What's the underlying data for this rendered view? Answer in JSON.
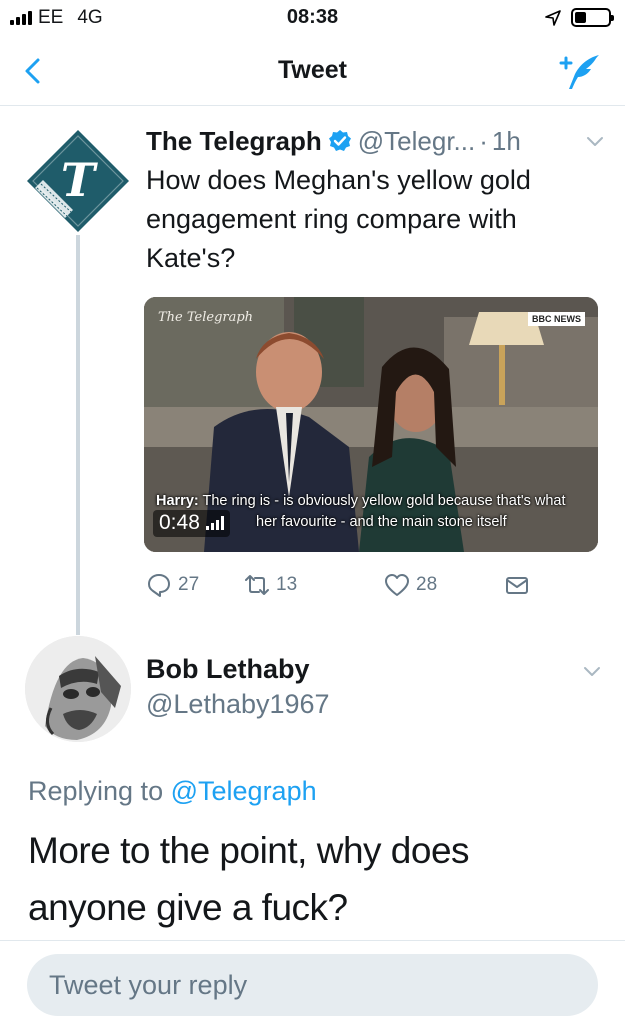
{
  "status_bar": {
    "carrier": "EE",
    "network": "4G",
    "time": "08:38",
    "battery_level": 0.35,
    "icons": [
      "signal-bars-icon",
      "location-arrow-icon",
      "battery-icon"
    ]
  },
  "nav": {
    "title": "Tweet",
    "back_icon": "chevron-left-icon",
    "compose_icon": "compose-tweet-icon"
  },
  "tweet": {
    "author_name": "The Telegraph",
    "verified": true,
    "handle": "@Telegr...",
    "separator": "·",
    "time": "1h",
    "text": "How does Meghan's yellow gold engagement ring compare with Kate's?",
    "media": {
      "logo": "The Telegraph",
      "badge": "BBC NEWS",
      "caption_speaker": "Harry:",
      "caption_line1": " The ring is - is obviously yellow gold because that's what",
      "caption_line2": "her favourite - and the main stone itself",
      "duration": "0:48"
    },
    "actions": {
      "replies": "27",
      "retweets": "13",
      "likes": "28"
    }
  },
  "reply": {
    "author_name": "Bob Lethaby",
    "handle": "@Lethaby1967",
    "replying_prefix": "Replying to",
    "replying_to": "@Telegraph",
    "text_line1": "More to the point, why does",
    "text_line2": "anyone give a fuck?"
  },
  "composer": {
    "placeholder": "Tweet your reply"
  },
  "colors": {
    "accent": "#1da1f2",
    "secondary_text": "#657786",
    "telegraph_brand": "#1f5c6a"
  }
}
